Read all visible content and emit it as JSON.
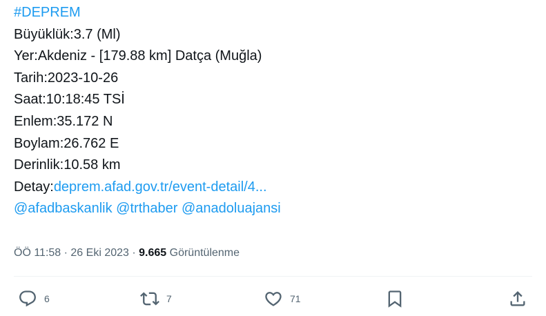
{
  "tweet": {
    "hashtag": "#DEPREM",
    "lines": [
      "Büyüklük:3.7 (Ml)",
      "Yer:Akdeniz - [179.88 km] Datça (Muğla)",
      "Tarih:2023-10-26",
      "Saat:10:18:45 TSİ",
      "Enlem:35.172 N",
      "Boylam:26.762 E",
      "Derinlik:10.58 km"
    ],
    "detail_label": "Detay:",
    "detail_link": "deprem.afad.gov.tr/event-detail/4...",
    "mentions": [
      "@afadbaskanlik",
      "@trthaber",
      "@anadoluajansi"
    ]
  },
  "meta": {
    "time": "ÖÖ 11:58",
    "sep1": " · ",
    "date": "26 Eki 2023",
    "sep2": " · ",
    "views_count": "9.665",
    "views_label": " Görüntülenme"
  },
  "actions": {
    "reply_count": "6",
    "retweet_count": "7",
    "like_count": "71"
  },
  "colors": {
    "accent": "#1d9bf0",
    "text": "#0f1419",
    "secondary": "#536471"
  }
}
